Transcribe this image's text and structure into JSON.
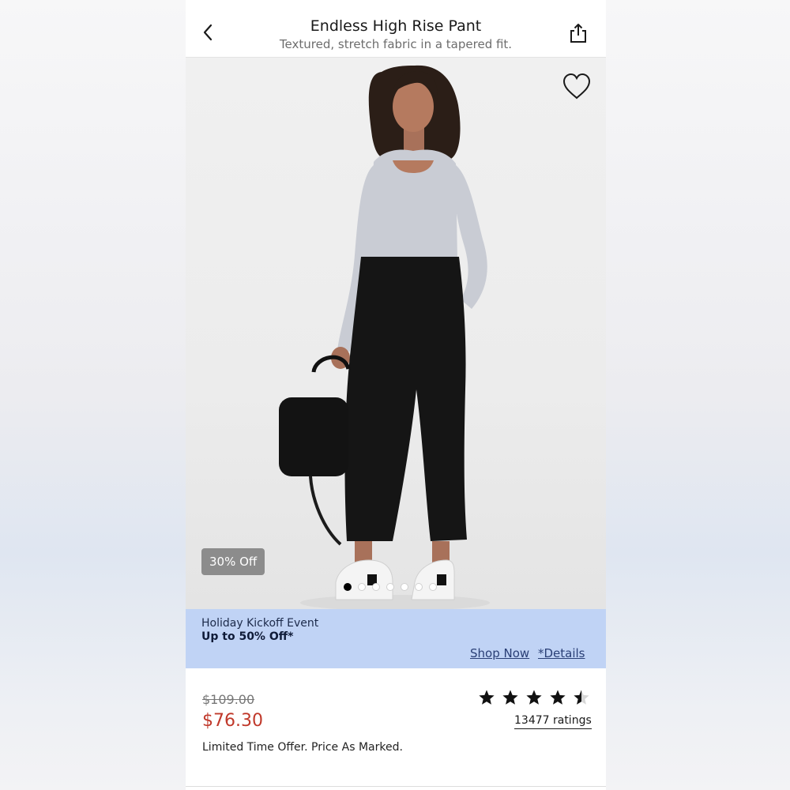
{
  "header": {
    "title": "Endless High Rise Pant",
    "subtitle": "Textured, stretch fabric in a tapered fit."
  },
  "gallery": {
    "badge": "30% Off",
    "dot_count": 7,
    "active_dot": 1
  },
  "promo": {
    "title": "Holiday Kickoff Event",
    "offer": "Up to 50% Off*",
    "shop_now": "Shop Now",
    "details": "*Details"
  },
  "price": {
    "original": "$109.00",
    "sale": "$76.30",
    "note": "Limited Time Offer. Price As Marked."
  },
  "rating": {
    "stars": 4.5,
    "count_label": "13477 ratings"
  },
  "colors": {
    "sale_price": "#c0392b",
    "promo_bg": "#c0d3f5",
    "badge_bg": "#8c8c8c"
  }
}
